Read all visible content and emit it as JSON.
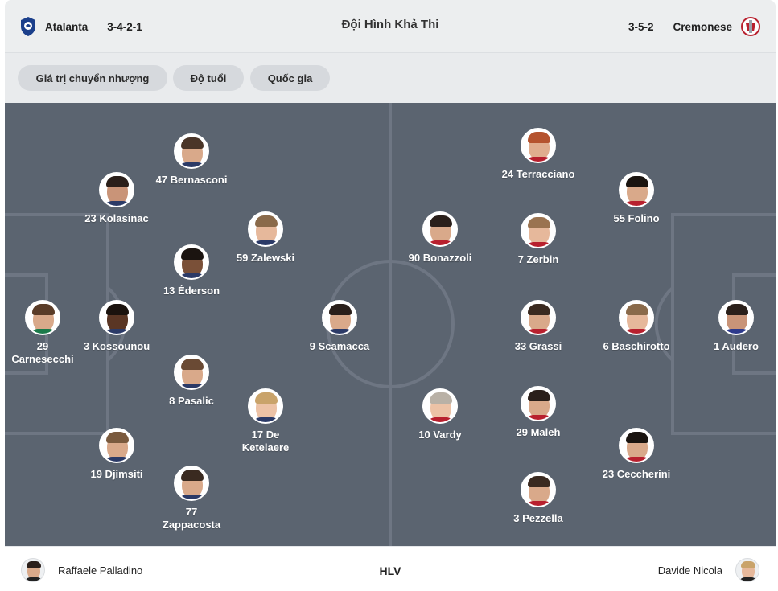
{
  "header": {
    "title": "Đội Hình Khả Thi",
    "home": {
      "name": "Atalanta",
      "formation": "3-4-2-1",
      "crest_icon": "atalanta-crest-icon",
      "crest_color": "#1b3f8b"
    },
    "away": {
      "name": "Cremonese",
      "formation": "3-5-2",
      "crest_icon": "cremonese-crest-icon",
      "crest_color": "#b8202e"
    }
  },
  "filters": [
    "Giá trị chuyển nhượng",
    "Độ tuổi",
    "Quốc gia"
  ],
  "colors": {
    "pitch": "#5b6470",
    "pitch_lines": "#6e7683",
    "header_bg": "#eceeef",
    "chip_bg": "#d6d9dd"
  },
  "home_players": [
    {
      "label": "47 Bernasconi"
    },
    {
      "label": "23 Kolasinac"
    },
    {
      "label": "59 Zalewski"
    },
    {
      "label": "13 Éderson"
    },
    {
      "label": "29 Carnesecchi"
    },
    {
      "label": "3 Kossounou"
    },
    {
      "label": "9 Scamacca"
    },
    {
      "label": "8 Pasalic"
    },
    {
      "label": "17 De Ketelaere"
    },
    {
      "label": "19 Djimsiti"
    },
    {
      "label": "77 Zappacosta"
    }
  ],
  "away_players": [
    {
      "label": "24 Terracciano"
    },
    {
      "label": "55 Folino"
    },
    {
      "label": "90 Bonazzoli"
    },
    {
      "label": "7 Zerbin"
    },
    {
      "label": "33 Grassi"
    },
    {
      "label": "6 Baschirotto"
    },
    {
      "label": "1 Audero"
    },
    {
      "label": "10 Vardy"
    },
    {
      "label": "29 Maleh"
    },
    {
      "label": "23 Ceccherini"
    },
    {
      "label": "3 Pezzella"
    }
  ],
  "footer": {
    "coach_label": "HLV",
    "home_coach": "Raffaele Palladino",
    "away_coach": "Davide Nicola"
  }
}
